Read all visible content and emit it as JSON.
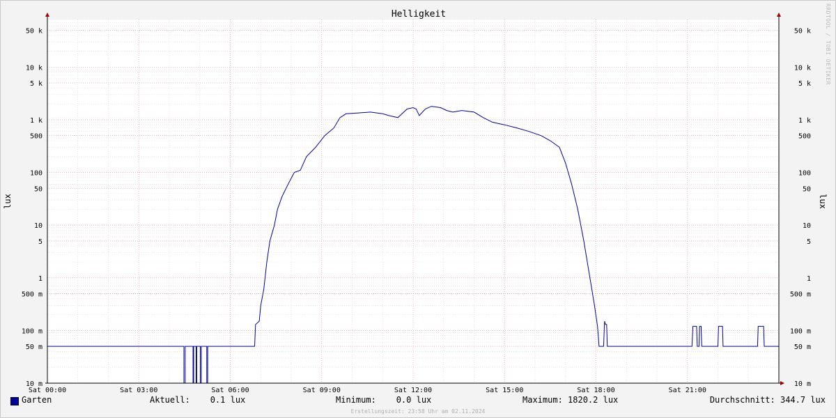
{
  "chart_data": {
    "type": "line",
    "title": "Helligkeit",
    "ylabel": "lux",
    "yscale": "log",
    "ylim": [
      0.01,
      80000
    ],
    "xlim": [
      0,
      24
    ],
    "grid": true,
    "x_ticks": [
      {
        "label": "Sat 00:00",
        "value": 0
      },
      {
        "label": "Sat 03:00",
        "value": 3
      },
      {
        "label": "Sat 06:00",
        "value": 6
      },
      {
        "label": "Sat 09:00",
        "value": 9
      },
      {
        "label": "Sat 12:00",
        "value": 12
      },
      {
        "label": "Sat 15:00",
        "value": 15
      },
      {
        "label": "Sat 18:00",
        "value": 18
      },
      {
        "label": "Sat 21:00",
        "value": 21
      }
    ],
    "y_ticks": [
      {
        "label": "50 k",
        "value": 50000
      },
      {
        "label": "10 k",
        "value": 10000
      },
      {
        "label": "5 k",
        "value": 5000
      },
      {
        "label": "1 k",
        "value": 1000
      },
      {
        "label": "500",
        "value": 500
      },
      {
        "label": "100",
        "value": 100
      },
      {
        "label": "50",
        "value": 50
      },
      {
        "label": "10",
        "value": 10
      },
      {
        "label": "5",
        "value": 5
      },
      {
        "label": "1",
        "value": 1
      },
      {
        "label": "500 m",
        "value": 0.5
      },
      {
        "label": "100 m",
        "value": 0.1
      },
      {
        "label": "50 m",
        "value": 0.05
      },
      {
        "label": "10 m",
        "value": 0.01
      }
    ],
    "series": [
      {
        "name": "Garten",
        "color": "#0000a0",
        "points": [
          [
            0,
            0.05
          ],
          [
            4.48,
            0.05
          ],
          [
            4.48,
            0.01
          ],
          [
            4.52,
            0.01
          ],
          [
            4.52,
            0.05
          ],
          [
            4.78,
            0.05
          ],
          [
            4.78,
            0.01
          ],
          [
            4.8,
            0.01
          ],
          [
            4.8,
            0.05
          ],
          [
            4.88,
            0.05
          ],
          [
            4.88,
            0.01
          ],
          [
            4.9,
            0.01
          ],
          [
            4.9,
            0.05
          ],
          [
            5.02,
            0.05
          ],
          [
            5.02,
            0.01
          ],
          [
            5.05,
            0.01
          ],
          [
            5.05,
            0.05
          ],
          [
            5.23,
            0.05
          ],
          [
            5.23,
            0.01
          ],
          [
            5.26,
            0.01
          ],
          [
            5.26,
            0.05
          ],
          [
            6.8,
            0.05
          ],
          [
            6.83,
            0.13
          ],
          [
            6.95,
            0.15
          ],
          [
            7.0,
            0.3
          ],
          [
            7.1,
            0.6
          ],
          [
            7.2,
            2
          ],
          [
            7.3,
            5
          ],
          [
            7.45,
            10
          ],
          [
            7.55,
            20
          ],
          [
            7.7,
            35
          ],
          [
            7.9,
            60
          ],
          [
            8.1,
            100
          ],
          [
            8.3,
            110
          ],
          [
            8.5,
            200
          ],
          [
            8.8,
            300
          ],
          [
            9.1,
            500
          ],
          [
            9.4,
            700
          ],
          [
            9.6,
            1100
          ],
          [
            9.8,
            1300
          ],
          [
            10.2,
            1350
          ],
          [
            10.6,
            1400
          ],
          [
            11.0,
            1300
          ],
          [
            11.2,
            1200
          ],
          [
            11.5,
            1100
          ],
          [
            11.8,
            1600
          ],
          [
            12.0,
            1700
          ],
          [
            12.1,
            1600
          ],
          [
            12.2,
            1200
          ],
          [
            12.4,
            1600
          ],
          [
            12.6,
            1800
          ],
          [
            12.9,
            1700
          ],
          [
            13.1,
            1500
          ],
          [
            13.3,
            1400
          ],
          [
            13.6,
            1500
          ],
          [
            14.0,
            1400
          ],
          [
            14.3,
            1100
          ],
          [
            14.6,
            900
          ],
          [
            15.0,
            800
          ],
          [
            15.4,
            700
          ],
          [
            15.8,
            600
          ],
          [
            16.2,
            500
          ],
          [
            16.5,
            400
          ],
          [
            16.8,
            300
          ],
          [
            17.0,
            150
          ],
          [
            17.2,
            60
          ],
          [
            17.4,
            20
          ],
          [
            17.6,
            5
          ],
          [
            17.8,
            1
          ],
          [
            17.95,
            0.3
          ],
          [
            18.05,
            0.12
          ],
          [
            18.1,
            0.05
          ],
          [
            18.25,
            0.05
          ],
          [
            18.28,
            0.15
          ],
          [
            18.31,
            0.13
          ],
          [
            18.35,
            0.13
          ],
          [
            18.37,
            0.05
          ],
          [
            21.15,
            0.05
          ],
          [
            21.18,
            0.12
          ],
          [
            21.3,
            0.12
          ],
          [
            21.32,
            0.05
          ],
          [
            21.38,
            0.05
          ],
          [
            21.4,
            0.12
          ],
          [
            21.45,
            0.12
          ],
          [
            21.47,
            0.05
          ],
          [
            22.0,
            0.05
          ],
          [
            22.02,
            0.12
          ],
          [
            22.15,
            0.12
          ],
          [
            22.17,
            0.05
          ],
          [
            23.3,
            0.05
          ],
          [
            23.32,
            0.12
          ],
          [
            23.5,
            0.12
          ],
          [
            23.52,
            0.05
          ],
          [
            24,
            0.05
          ]
        ]
      }
    ],
    "legend": {
      "placement": "bottom-left",
      "current": "Aktuell:    0.1 lux",
      "minimum": "Minimum:    0.0 lux",
      "maximum": "Maximum: 1820.2 lux",
      "average": "Durchschnitt: 344.7 lux"
    }
  },
  "footer": "Erstellungszeit: 23:58 Uhr am 02.11.2024",
  "watermark": "RRDTOOL / TOBI OETIKER",
  "colors": {
    "background": "#f3f3f3",
    "plot_bg": "#ffffff",
    "line": "#0000a0",
    "major_grid": "#e4a0a0",
    "minor_grid": "#d8d8d8",
    "axis": "#000000",
    "arrow": "#a00000"
  }
}
